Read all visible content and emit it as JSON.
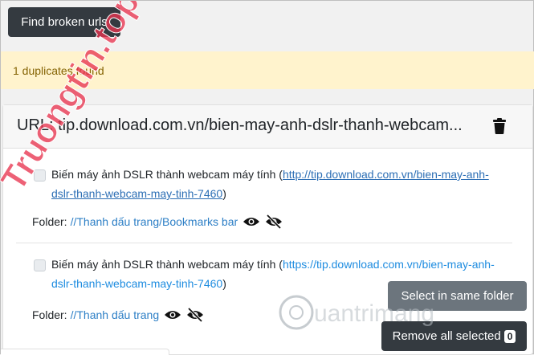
{
  "toolbar": {
    "find_broken_label": "Find broken urls"
  },
  "alert": {
    "text": "1 duplicates found"
  },
  "card": {
    "url_title": "URL: tip.download.com.vn/bien-may-anh-dslr-thanh-webcam...",
    "items": [
      {
        "title": "Biến máy ảnh DSLR thành webcam máy tính",
        "url": "http://tip.download.com.vn/bien-may-anh-dslr-thanh-webcam-may-tinh-7460",
        "folder_label": "Folder:",
        "folder_path": "//Thanh dấu trang/Bookmarks bar"
      },
      {
        "title": "Biến máy ảnh DSLR thành webcam máy tính",
        "url": "https://tip.download.com.vn/bien-may-anh-dslr-thanh-webcam-may-tinh-7460",
        "folder_label": "Folder:",
        "folder_path": "//Thanh dấu trang"
      }
    ]
  },
  "actions": {
    "select_same_folder_label": "Select in same folder",
    "remove_selected_label": "Remove all selected",
    "selected_count": "0"
  },
  "watermark": {
    "text": "Truongtin.top",
    "bottom_text": "uantrimang"
  },
  "icons": {
    "trash": "trash-icon",
    "show": "eye-icon",
    "hide": "eye-slash-icon"
  },
  "colors": {
    "dark_button": "#343a40",
    "gray_button": "#6c757d",
    "alert_bg": "#fff3cd",
    "alert_text": "#856404",
    "link": "#2d7fc6",
    "watermark": "#e8344f"
  }
}
